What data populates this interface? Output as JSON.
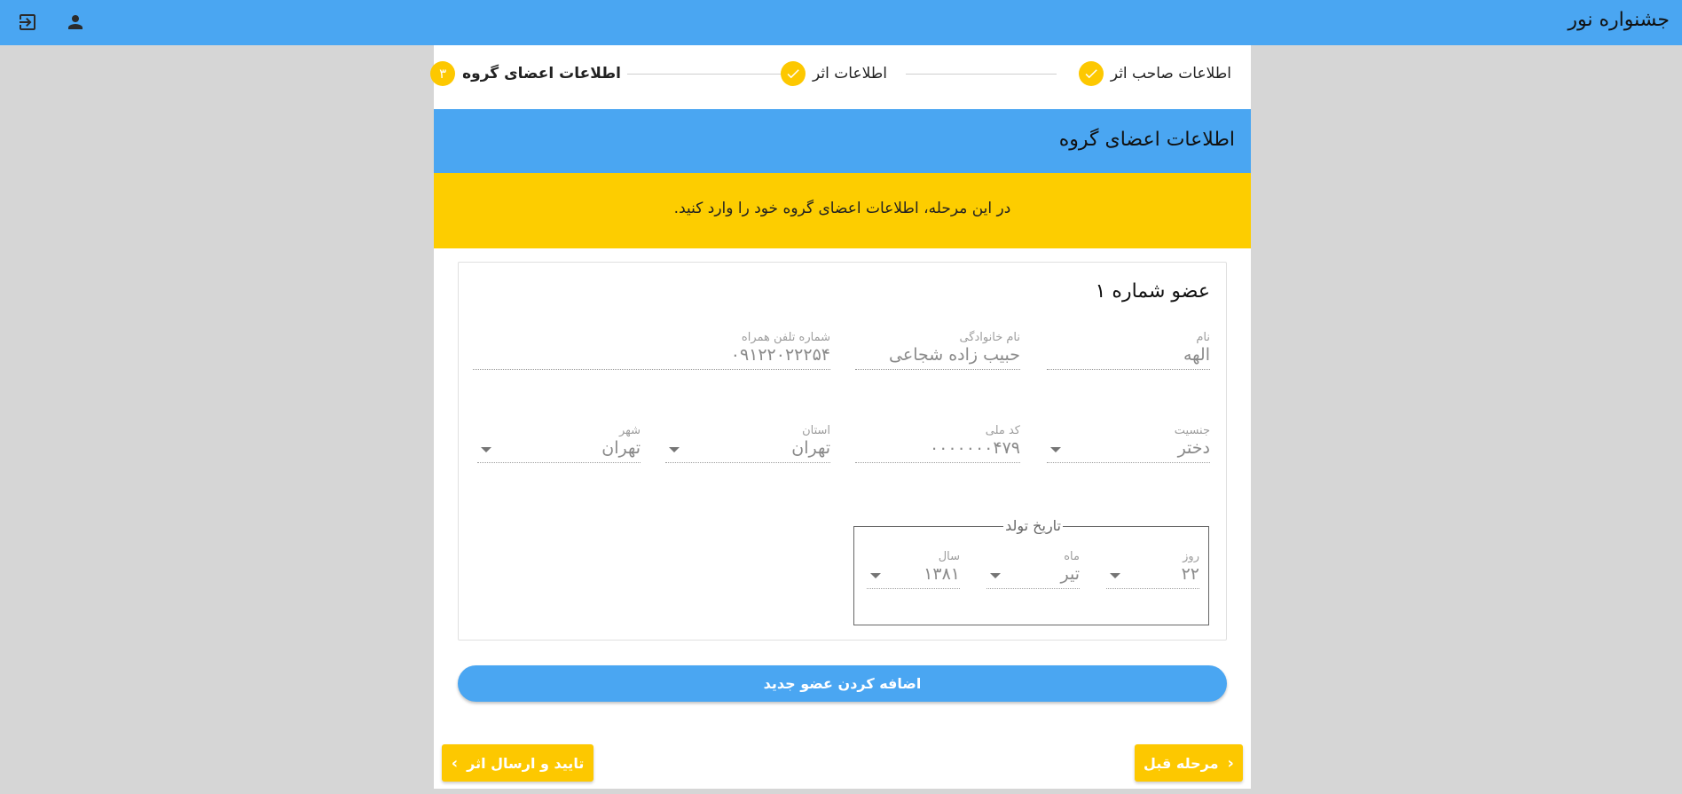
{
  "app": {
    "title": "جشنواره نور"
  },
  "stepper": {
    "steps": [
      {
        "label": "اطلاعات صاحب اثر",
        "status": "done"
      },
      {
        "label": "اطلاعات اثر",
        "status": "done"
      },
      {
        "label": "اطلاعات اعضای گروه",
        "status": "active",
        "number": "۳"
      }
    ]
  },
  "section": {
    "title": "اطلاعات اعضای گروه",
    "notice": "در این مرحله، اطلاعات اعضای گروه خود را وارد کنید."
  },
  "member": {
    "title": "عضو شماره ۱",
    "first_name": {
      "label": "نام",
      "value": "الهه"
    },
    "last_name": {
      "label": "نام خانوادگی",
      "value": "حبیب زاده شجاعی"
    },
    "phone": {
      "label": "شماره تلفن همراه",
      "value": "۰۹۱۲۲۰۲۲۲۵۴"
    },
    "gender": {
      "label": "جنسیت",
      "value": "دختر"
    },
    "national_code": {
      "label": "کد ملی",
      "value": "۰۰۰۰۰۰۰۴۷۹"
    },
    "province": {
      "label": "استان",
      "value": "تهران"
    },
    "city": {
      "label": "شهر",
      "value": "تهران"
    },
    "birth_date": {
      "legend": "تاریخ تولد",
      "day": {
        "label": "روز",
        "value": "۲۲"
      },
      "month": {
        "label": "ماه",
        "value": "تیر"
      },
      "year": {
        "label": "سال",
        "value": "۱۳۸۱"
      }
    }
  },
  "actions": {
    "add_member": "اضافه کردن عضو جدید",
    "previous": "مرحله قبل",
    "submit": "تایید و ارسال اثر"
  },
  "colors": {
    "primary": "#4aa6f2",
    "accent": "#fdc800",
    "background": "#d6d6d6"
  }
}
